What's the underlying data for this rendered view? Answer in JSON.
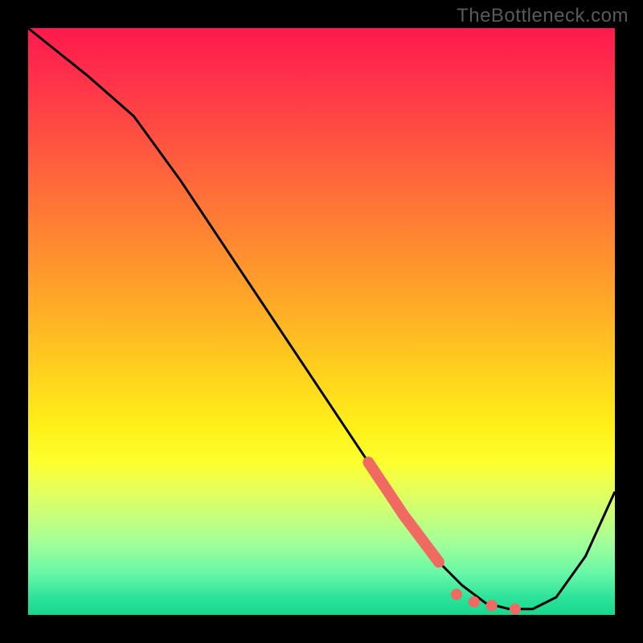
{
  "watermark": "TheBottleneck.com",
  "chart_data": {
    "type": "line",
    "title": "",
    "xlabel": "",
    "ylabel": "",
    "xlim": [
      0,
      100
    ],
    "ylim": [
      0,
      100
    ],
    "grid": false,
    "legend": false,
    "series": [
      {
        "name": "bottleneck-curve",
        "x": [
          0,
          10,
          18,
          26,
          34,
          42,
          50,
          58,
          64,
          70,
          74,
          78,
          82,
          86,
          90,
          95,
          100
        ],
        "y": [
          100,
          92,
          85,
          74,
          62,
          50,
          38,
          26,
          17,
          9,
          5,
          2,
          1,
          1,
          3,
          10,
          21
        ]
      }
    ],
    "markers": [
      {
        "name": "thick-segment",
        "x_start": 58,
        "x_end": 70,
        "kind": "line",
        "color": "#f06a62"
      },
      {
        "name": "dot-1",
        "x": 73,
        "y": 3.5,
        "kind": "dot",
        "color": "#f06a62"
      },
      {
        "name": "dot-2",
        "x": 76,
        "y": 2.2,
        "kind": "dot",
        "color": "#f06a62"
      },
      {
        "name": "dot-3",
        "x": 79,
        "y": 1.6,
        "kind": "dot",
        "color": "#f06a62"
      },
      {
        "name": "dot-4",
        "x": 83,
        "y": 1.0,
        "kind": "dot",
        "color": "#f06a62"
      }
    ],
    "colors": {
      "curve": "#000000",
      "marker": "#f06a62",
      "gradient_top": "#ff1a4d",
      "gradient_bottom": "#17d88e"
    }
  }
}
